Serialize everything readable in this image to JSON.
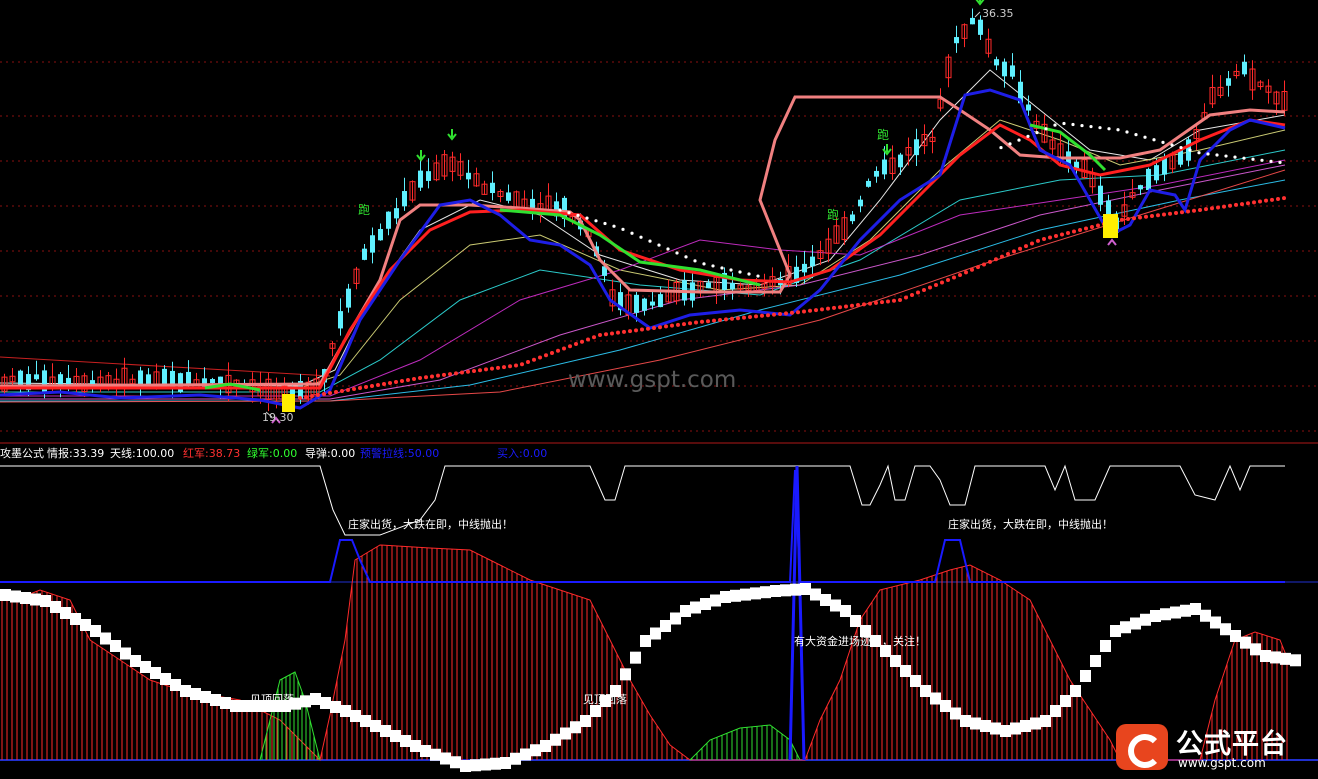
{
  "watermark": "www.gspt.com",
  "price_labels": {
    "high": "36.35",
    "low": "19.30"
  },
  "run_marker": "跑",
  "indicator_bar": [
    {
      "text": "攻墨公式",
      "color": "#ffffff"
    },
    {
      "text": "情报:33.39",
      "color": "#ffffff"
    },
    {
      "text": "天线:100.00",
      "color": "#ffffff"
    },
    {
      "text": "红军:38.73",
      "color": "#ff3030"
    },
    {
      "text": "绿军:0.00",
      "color": "#30ff30"
    },
    {
      "text": "导弹:0.00",
      "color": "#ffffff"
    },
    {
      "text": "预警拉线:50.00",
      "color": "#1a1aff"
    },
    {
      "text": "买入:0.00",
      "color": "#1a1aff"
    }
  ],
  "annotations": {
    "distribution": "庄家出货，大跌在即，中线抛出！",
    "capital_inflow": "有大资金进场迹象，关注！",
    "pullback": "见顶回落"
  },
  "logo": {
    "brand": "公式平台",
    "url": "www.gspt.com"
  },
  "colors": {
    "up": "#ff2a2a",
    "down": "#5ff0ff",
    "ma_red": "#ff2020",
    "ma_pink": "#f08080",
    "ma_blue": "#1e1ee6",
    "ma_green": "#30e030",
    "dots": "#ff3030"
  },
  "chart_data": [
    {
      "type": "line",
      "panel": "price",
      "x": [
        0,
        10,
        20,
        30,
        40,
        50,
        60,
        70,
        80,
        90,
        100,
        110,
        120,
        130,
        140,
        150,
        160,
        170,
        180,
        190
      ],
      "series": [
        {
          "name": "close",
          "values": [
            20.1,
            20.3,
            20.0,
            20.4,
            20.2,
            19.3,
            20.5,
            26.5,
            28.8,
            30.8,
            28.9,
            29.1,
            25.8,
            25.6,
            25.9,
            26.1,
            28.0,
            30.5,
            36.35,
            31.5
          ]
        }
      ],
      "ylim": [
        18.5,
        37
      ]
    },
    {
      "type": "area",
      "panel": "indicator",
      "series": [
        {
          "name": "情报",
          "values": [
            100,
            100,
            100,
            85,
            85,
            100,
            100,
            100,
            100,
            100,
            90,
            100,
            90,
            100,
            100,
            100,
            90,
            100,
            90,
            100,
            100
          ]
        },
        {
          "name": "红军",
          "values": [
            70,
            60,
            40,
            35,
            10,
            0,
            80,
            80,
            70,
            55,
            40,
            10,
            0,
            0,
            60,
            70,
            50,
            30,
            10,
            40,
            50
          ]
        },
        {
          "name": "绿军",
          "values": [
            0,
            0,
            0,
            0,
            60,
            0,
            0,
            0,
            0,
            0,
            0,
            0,
            20,
            20,
            0,
            0,
            0,
            0,
            0,
            0,
            0
          ]
        }
      ]
    }
  ]
}
